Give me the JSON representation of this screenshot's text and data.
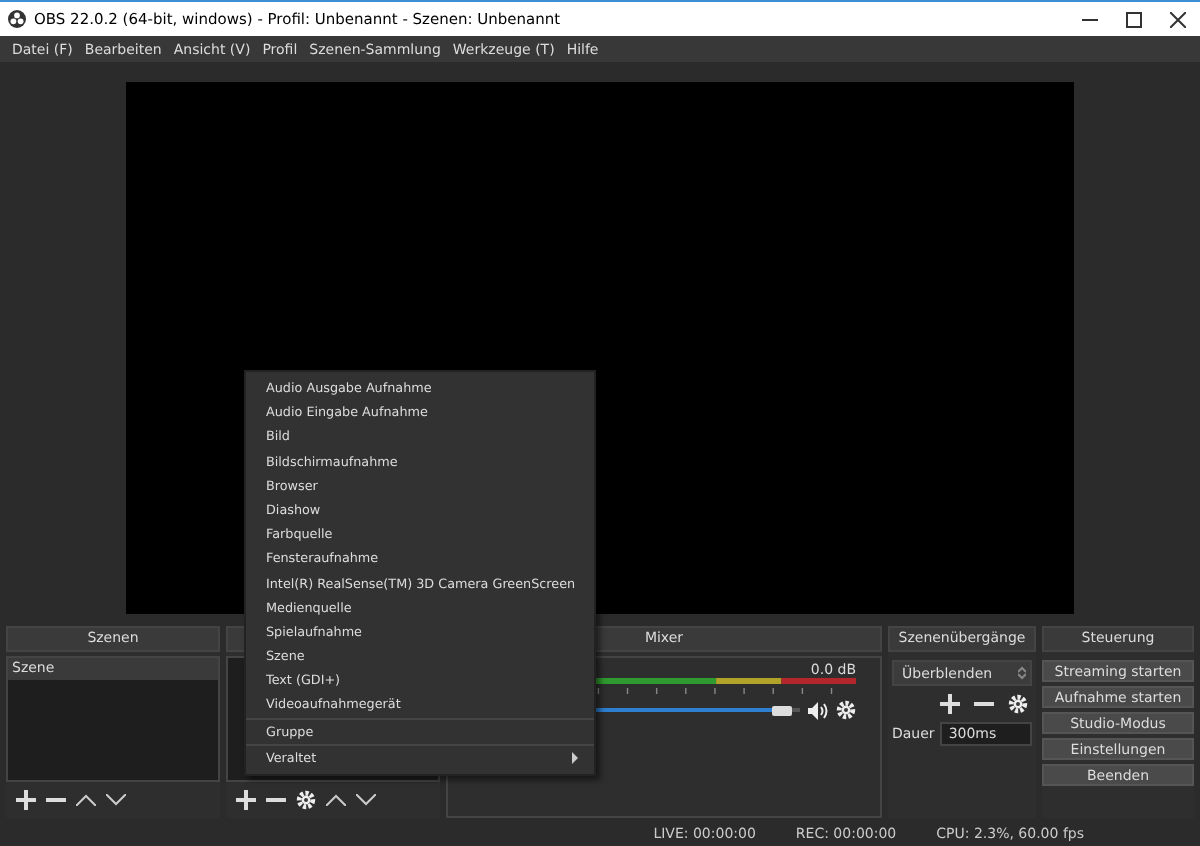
{
  "window": {
    "title": "OBS 22.0.2 (64-bit, windows) - Profil: Unbenannt - Szenen: Unbenannt"
  },
  "menubar": [
    "Datei (F)",
    "Bearbeiten",
    "Ansicht (V)",
    "Profil",
    "Szenen-Sammlung",
    "Werkzeuge (T)",
    "Hilfe"
  ],
  "scenes": {
    "title": "Szenen",
    "items": [
      {
        "label": "Szene",
        "selected": true
      }
    ]
  },
  "mixer": {
    "title": "Mixer",
    "reading": "0.0 dB",
    "level": 0.95,
    "muted": false
  },
  "transitions": {
    "title": "Szenenübergänge",
    "transition": "Überblenden",
    "duration_label": "Dauer",
    "duration": "300ms"
  },
  "controls": {
    "title": "Steuerung",
    "buttons": [
      "Streaming starten",
      "Aufnahme starten",
      "Studio-Modus",
      "Einstellungen",
      "Beenden"
    ]
  },
  "context_menu": {
    "sections": [
      [
        {
          "label": "Audio Ausgabe Aufnahme",
          "submenu": false
        },
        {
          "label": "Audio Eingabe Aufnahme",
          "submenu": false
        },
        {
          "label": "Bild",
          "submenu": false
        },
        {
          "label": "Bildschirmaufnahme",
          "submenu": false
        },
        {
          "label": "Browser",
          "submenu": false
        },
        {
          "label": "Diashow",
          "submenu": false
        },
        {
          "label": "Farbquelle",
          "submenu": false
        },
        {
          "label": "Fensteraufnahme",
          "submenu": false
        },
        {
          "label": "Intel(R) RealSense(TM) 3D Camera GreenScreen",
          "submenu": false
        },
        {
          "label": "Medienquelle",
          "submenu": false
        },
        {
          "label": "Spielaufnahme",
          "submenu": false
        },
        {
          "label": "Szene",
          "submenu": false
        },
        {
          "label": "Text (GDI+)",
          "submenu": false
        },
        {
          "label": "Videoaufnahmegerät",
          "submenu": false
        }
      ],
      [
        {
          "label": "Gruppe",
          "submenu": false
        }
      ],
      [
        {
          "label": "Veraltet",
          "submenu": true
        }
      ]
    ]
  },
  "status_bar": [
    "LIVE: 00:00:00",
    "REC: 00:00:00",
    "CPU: 2.3%, 60.00 fps"
  ]
}
